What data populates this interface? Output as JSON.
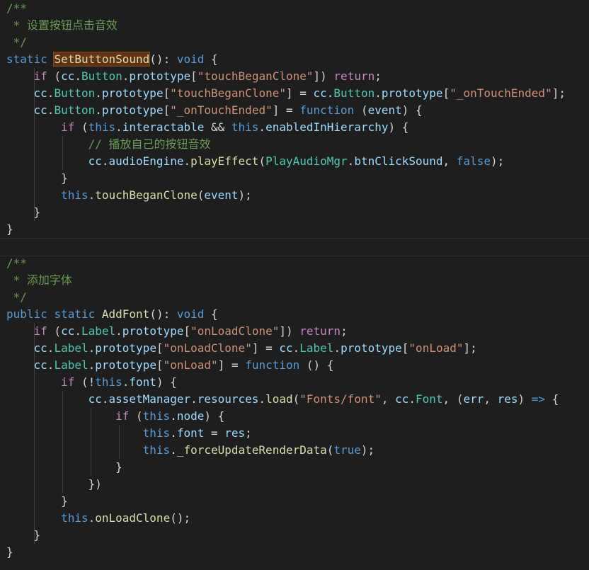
{
  "colors": {
    "background": "#1e1e1e",
    "comment": "#6a9955",
    "keyword": "#569cd6",
    "control": "#c586c0",
    "function": "#dcdcaa",
    "class": "#4ec9b0",
    "property": "#9cdcfe",
    "string": "#ce9178",
    "default": "#d4d4d4",
    "highlight": "#613214"
  },
  "blocks": [
    {
      "lines": [
        [
          [
            "cm",
            "/**"
          ]
        ],
        [
          [
            "cm",
            " * 设置按钮点击音效"
          ]
        ],
        [
          [
            "cm",
            " */"
          ]
        ],
        [
          [
            "kw",
            "static "
          ],
          [
            "fn hl",
            "SetButtonSound"
          ],
          [
            "pun",
            "(): "
          ],
          [
            "kw",
            "void"
          ],
          [
            "pun",
            " {"
          ]
        ],
        [
          [
            "pun",
            "    "
          ],
          [
            "ctl",
            "if"
          ],
          [
            "pun",
            " ("
          ],
          [
            "prop",
            "cc"
          ],
          [
            "pun",
            "."
          ],
          [
            "cls",
            "Button"
          ],
          [
            "pun",
            "."
          ],
          [
            "prop",
            "prototype"
          ],
          [
            "pun",
            "["
          ],
          [
            "str",
            "\"touchBeganClone\""
          ],
          [
            "pun",
            "]) "
          ],
          [
            "ctl",
            "return"
          ],
          [
            "pun",
            ";"
          ]
        ],
        [
          [
            "pun",
            "    "
          ],
          [
            "prop",
            "cc"
          ],
          [
            "pun",
            "."
          ],
          [
            "cls",
            "Button"
          ],
          [
            "pun",
            "."
          ],
          [
            "prop",
            "prototype"
          ],
          [
            "pun",
            "["
          ],
          [
            "str",
            "\"touchBeganClone\""
          ],
          [
            "pun",
            "] = "
          ],
          [
            "prop",
            "cc"
          ],
          [
            "pun",
            "."
          ],
          [
            "cls",
            "Button"
          ],
          [
            "pun",
            "."
          ],
          [
            "prop",
            "prototype"
          ],
          [
            "pun",
            "["
          ],
          [
            "str",
            "\"_onTouchEnded\""
          ],
          [
            "pun",
            "];"
          ]
        ],
        [
          [
            "pun",
            "    "
          ],
          [
            "prop",
            "cc"
          ],
          [
            "pun",
            "."
          ],
          [
            "cls",
            "Button"
          ],
          [
            "pun",
            "."
          ],
          [
            "prop",
            "prototype"
          ],
          [
            "pun",
            "["
          ],
          [
            "str",
            "\"_onTouchEnded\""
          ],
          [
            "pun",
            "] = "
          ],
          [
            "kw",
            "function"
          ],
          [
            "pun",
            " ("
          ],
          [
            "prop",
            "event"
          ],
          [
            "pun",
            ") {"
          ]
        ],
        [
          [
            "pun",
            "        "
          ],
          [
            "ctl",
            "if"
          ],
          [
            "pun",
            " ("
          ],
          [
            "kw",
            "this"
          ],
          [
            "pun",
            "."
          ],
          [
            "prop",
            "interactable"
          ],
          [
            "pun",
            " && "
          ],
          [
            "kw",
            "this"
          ],
          [
            "pun",
            "."
          ],
          [
            "prop",
            "enabledInHierarchy"
          ],
          [
            "pun",
            ") {"
          ]
        ],
        [
          [
            "pun",
            "            "
          ],
          [
            "cm",
            "// 播放自己的按钮音效"
          ]
        ],
        [
          [
            "pun",
            "            "
          ],
          [
            "prop",
            "cc"
          ],
          [
            "pun",
            "."
          ],
          [
            "prop",
            "audioEngine"
          ],
          [
            "pun",
            "."
          ],
          [
            "fn",
            "playEffect"
          ],
          [
            "pun",
            "("
          ],
          [
            "cls",
            "PlayAudioMgr"
          ],
          [
            "pun",
            "."
          ],
          [
            "prop",
            "btnClickSound"
          ],
          [
            "pun",
            ", "
          ],
          [
            "kw",
            "false"
          ],
          [
            "pun",
            ");"
          ]
        ],
        [
          [
            "pun",
            "        }"
          ]
        ],
        [
          [
            "pun",
            "        "
          ],
          [
            "kw",
            "this"
          ],
          [
            "pun",
            "."
          ],
          [
            "fn",
            "touchBeganClone"
          ],
          [
            "pun",
            "("
          ],
          [
            "prop",
            "event"
          ],
          [
            "pun",
            ");"
          ]
        ],
        [
          [
            "pun",
            "    }"
          ]
        ],
        [
          [
            "pun",
            "}"
          ]
        ]
      ]
    },
    {
      "lines": [
        [
          [
            "cm",
            "/**"
          ]
        ],
        [
          [
            "cm",
            " * 添加字体"
          ]
        ],
        [
          [
            "cm",
            " */"
          ]
        ],
        [
          [
            "kw",
            "public"
          ],
          [
            "pun",
            " "
          ],
          [
            "kw",
            "static "
          ],
          [
            "fn",
            "AddFont"
          ],
          [
            "pun",
            "(): "
          ],
          [
            "kw",
            "void"
          ],
          [
            "pun",
            " {"
          ]
        ],
        [
          [
            "pun",
            "    "
          ],
          [
            "ctl",
            "if"
          ],
          [
            "pun",
            " ("
          ],
          [
            "prop",
            "cc"
          ],
          [
            "pun",
            "."
          ],
          [
            "cls",
            "Label"
          ],
          [
            "pun",
            "."
          ],
          [
            "prop",
            "prototype"
          ],
          [
            "pun",
            "["
          ],
          [
            "str",
            "\"onLoadClone\""
          ],
          [
            "pun",
            "]) "
          ],
          [
            "ctl",
            "return"
          ],
          [
            "pun",
            ";"
          ]
        ],
        [
          [
            "pun",
            "    "
          ],
          [
            "prop",
            "cc"
          ],
          [
            "pun",
            "."
          ],
          [
            "cls",
            "Label"
          ],
          [
            "pun",
            "."
          ],
          [
            "prop",
            "prototype"
          ],
          [
            "pun",
            "["
          ],
          [
            "str",
            "\"onLoadClone\""
          ],
          [
            "pun",
            "] = "
          ],
          [
            "prop",
            "cc"
          ],
          [
            "pun",
            "."
          ],
          [
            "cls",
            "Label"
          ],
          [
            "pun",
            "."
          ],
          [
            "prop",
            "prototype"
          ],
          [
            "pun",
            "["
          ],
          [
            "str",
            "\"onLoad\""
          ],
          [
            "pun",
            "];"
          ]
        ],
        [
          [
            "pun",
            "    "
          ],
          [
            "prop",
            "cc"
          ],
          [
            "pun",
            "."
          ],
          [
            "cls",
            "Label"
          ],
          [
            "pun",
            "."
          ],
          [
            "prop",
            "prototype"
          ],
          [
            "pun",
            "["
          ],
          [
            "str",
            "\"onLoad\""
          ],
          [
            "pun",
            "] = "
          ],
          [
            "kw",
            "function"
          ],
          [
            "pun",
            " () {"
          ]
        ],
        [
          [
            "pun",
            "        "
          ],
          [
            "ctl",
            "if"
          ],
          [
            "pun",
            " (!"
          ],
          [
            "kw",
            "this"
          ],
          [
            "pun",
            "."
          ],
          [
            "prop",
            "font"
          ],
          [
            "pun",
            ") {"
          ]
        ],
        [
          [
            "pun",
            "            "
          ],
          [
            "prop",
            "cc"
          ],
          [
            "pun",
            "."
          ],
          [
            "prop",
            "assetManager"
          ],
          [
            "pun",
            "."
          ],
          [
            "prop",
            "resources"
          ],
          [
            "pun",
            "."
          ],
          [
            "fn",
            "load"
          ],
          [
            "pun",
            "("
          ],
          [
            "str",
            "\"Fonts/font\""
          ],
          [
            "pun",
            ", "
          ],
          [
            "prop",
            "cc"
          ],
          [
            "pun",
            "."
          ],
          [
            "cls",
            "Font"
          ],
          [
            "pun",
            ", ("
          ],
          [
            "prop",
            "err"
          ],
          [
            "pun",
            ", "
          ],
          [
            "prop",
            "res"
          ],
          [
            "pun",
            ") "
          ],
          [
            "kw",
            "=>"
          ],
          [
            "pun",
            " {"
          ]
        ],
        [
          [
            "pun",
            "                "
          ],
          [
            "ctl",
            "if"
          ],
          [
            "pun",
            " ("
          ],
          [
            "kw",
            "this"
          ],
          [
            "pun",
            "."
          ],
          [
            "prop",
            "node"
          ],
          [
            "pun",
            ") {"
          ]
        ],
        [
          [
            "pun",
            "                    "
          ],
          [
            "kw",
            "this"
          ],
          [
            "pun",
            "."
          ],
          [
            "prop",
            "font"
          ],
          [
            "pun",
            " = "
          ],
          [
            "prop",
            "res"
          ],
          [
            "pun",
            ";"
          ]
        ],
        [
          [
            "pun",
            "                    "
          ],
          [
            "kw",
            "this"
          ],
          [
            "pun",
            "."
          ],
          [
            "fn",
            "_forceUpdateRenderData"
          ],
          [
            "pun",
            "("
          ],
          [
            "kw",
            "true"
          ],
          [
            "pun",
            ");"
          ]
        ],
        [
          [
            "pun",
            "                }"
          ]
        ],
        [
          [
            "pun",
            "            })"
          ]
        ],
        [
          [
            "pun",
            "        }"
          ]
        ],
        [
          [
            "pun",
            "        "
          ],
          [
            "kw",
            "this"
          ],
          [
            "pun",
            "."
          ],
          [
            "fn",
            "onLoadClone"
          ],
          [
            "pun",
            "();"
          ]
        ],
        [
          [
            "pun",
            "    }"
          ]
        ],
        [
          [
            "pun",
            "}"
          ]
        ]
      ]
    }
  ]
}
